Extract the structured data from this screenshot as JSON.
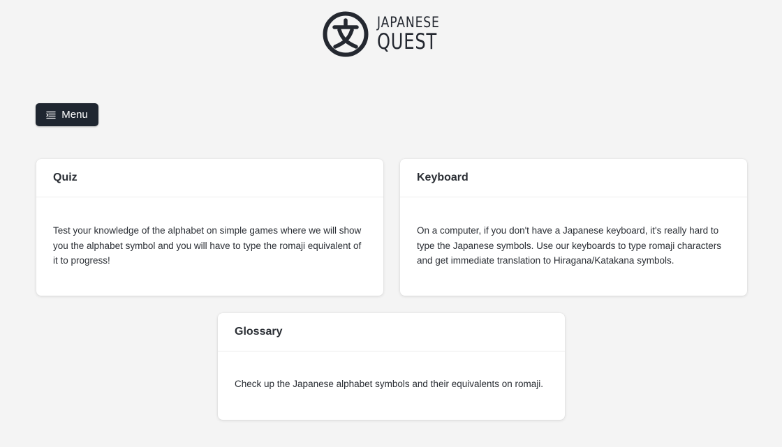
{
  "logo": {
    "line1": "JAPANESE",
    "line2": "QUEST",
    "icon": "kanji-bun-circle-icon"
  },
  "menu": {
    "label": "Menu",
    "icon": "list-menu-icon"
  },
  "cards": {
    "quiz": {
      "title": "Quiz",
      "text": "Test your knowledge of the alphabet on simple games where we will show you the alphabet symbol and you will have to type the romaji equivalent of it to progress!"
    },
    "keyboard": {
      "title": "Keyboard",
      "text": "On a computer, if you don't have a Japanese keyboard, it's really hard to type the Japanese symbols. Use our keyboards to type romaji characters and get immediate translation to Hiragana/Katakana symbols."
    },
    "glossary": {
      "title": "Glossary",
      "text": "Check up the Japanese alphabet symbols and their equivalents on romaji."
    }
  },
  "colors": {
    "background": "#f4f4f4",
    "button": "#1f2630",
    "card": "#ffffff",
    "text": "#2a2e34"
  }
}
